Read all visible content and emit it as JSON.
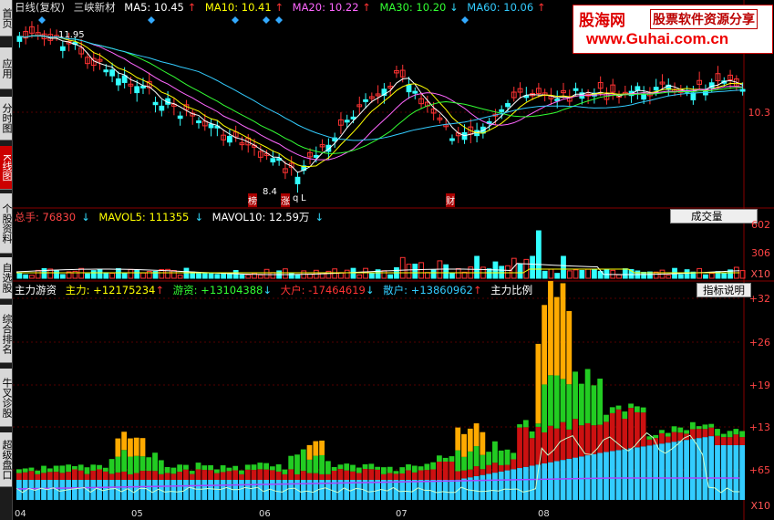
{
  "sidebar": {
    "tabs": [
      {
        "label": "首页",
        "active": false
      },
      {
        "label": "应用",
        "active": false
      },
      {
        "label": "分时图",
        "active": false
      },
      {
        "label": "K线图",
        "active": true
      },
      {
        "label": "个股资料",
        "active": false
      },
      {
        "label": "自选股",
        "active": false
      },
      {
        "label": "综合排名",
        "active": false
      },
      {
        "label": "牛叉诊股",
        "active": false
      },
      {
        "label": "超级盘口",
        "active": false
      }
    ]
  },
  "kline": {
    "period": "日线(复权)",
    "stock": "三峡新材",
    "ma": [
      {
        "label": "MA5: 10.45",
        "color": "#ffffff",
        "dir": "up"
      },
      {
        "label": "MA10: 10.41",
        "color": "#ffff00",
        "dir": "up"
      },
      {
        "label": "MA20: 10.22",
        "color": "#ff66ff",
        "dir": "up"
      },
      {
        "label": "MA30: 10.20",
        "color": "#33ff33",
        "dir": "down"
      },
      {
        "label": "MA60: 10.06",
        "color": "#33ccff",
        "dir": "up"
      }
    ],
    "axis": [
      "10.3"
    ],
    "annotations": {
      "high": "11.95",
      "low": "8.4",
      "tag_bang": "榜",
      "tag_zhang": "涨",
      "tag_q": "q",
      "tag_l": "L",
      "tag_cai": "财"
    }
  },
  "volume": {
    "total": "总手: 76830",
    "mavol5": "MAVOL5: 111355",
    "mavol10": "MAVOL10: 12.59万",
    "button": "成交量",
    "axis": [
      "602",
      "306",
      "X10"
    ]
  },
  "moneyflow": {
    "title": "主力游资",
    "main": "主力: +12175234",
    "hot": "游资: +13104388",
    "large": "大户: -17464619",
    "retail": "散户: +13860962",
    "ratio": "主力比例",
    "button": "指标说明",
    "axis": [
      "+32",
      "+26",
      "+19",
      "+13",
      "+65",
      "X10"
    ]
  },
  "xaxis": [
    "04",
    "05",
    "06",
    "07",
    "08"
  ],
  "logo": {
    "main": "股海网",
    "sub": "股票软件资源分享",
    "url": "www.Guhai.com.cn"
  },
  "colors": {
    "up": "#ff3333",
    "down": "#33ffff",
    "bg": "#000000"
  }
}
